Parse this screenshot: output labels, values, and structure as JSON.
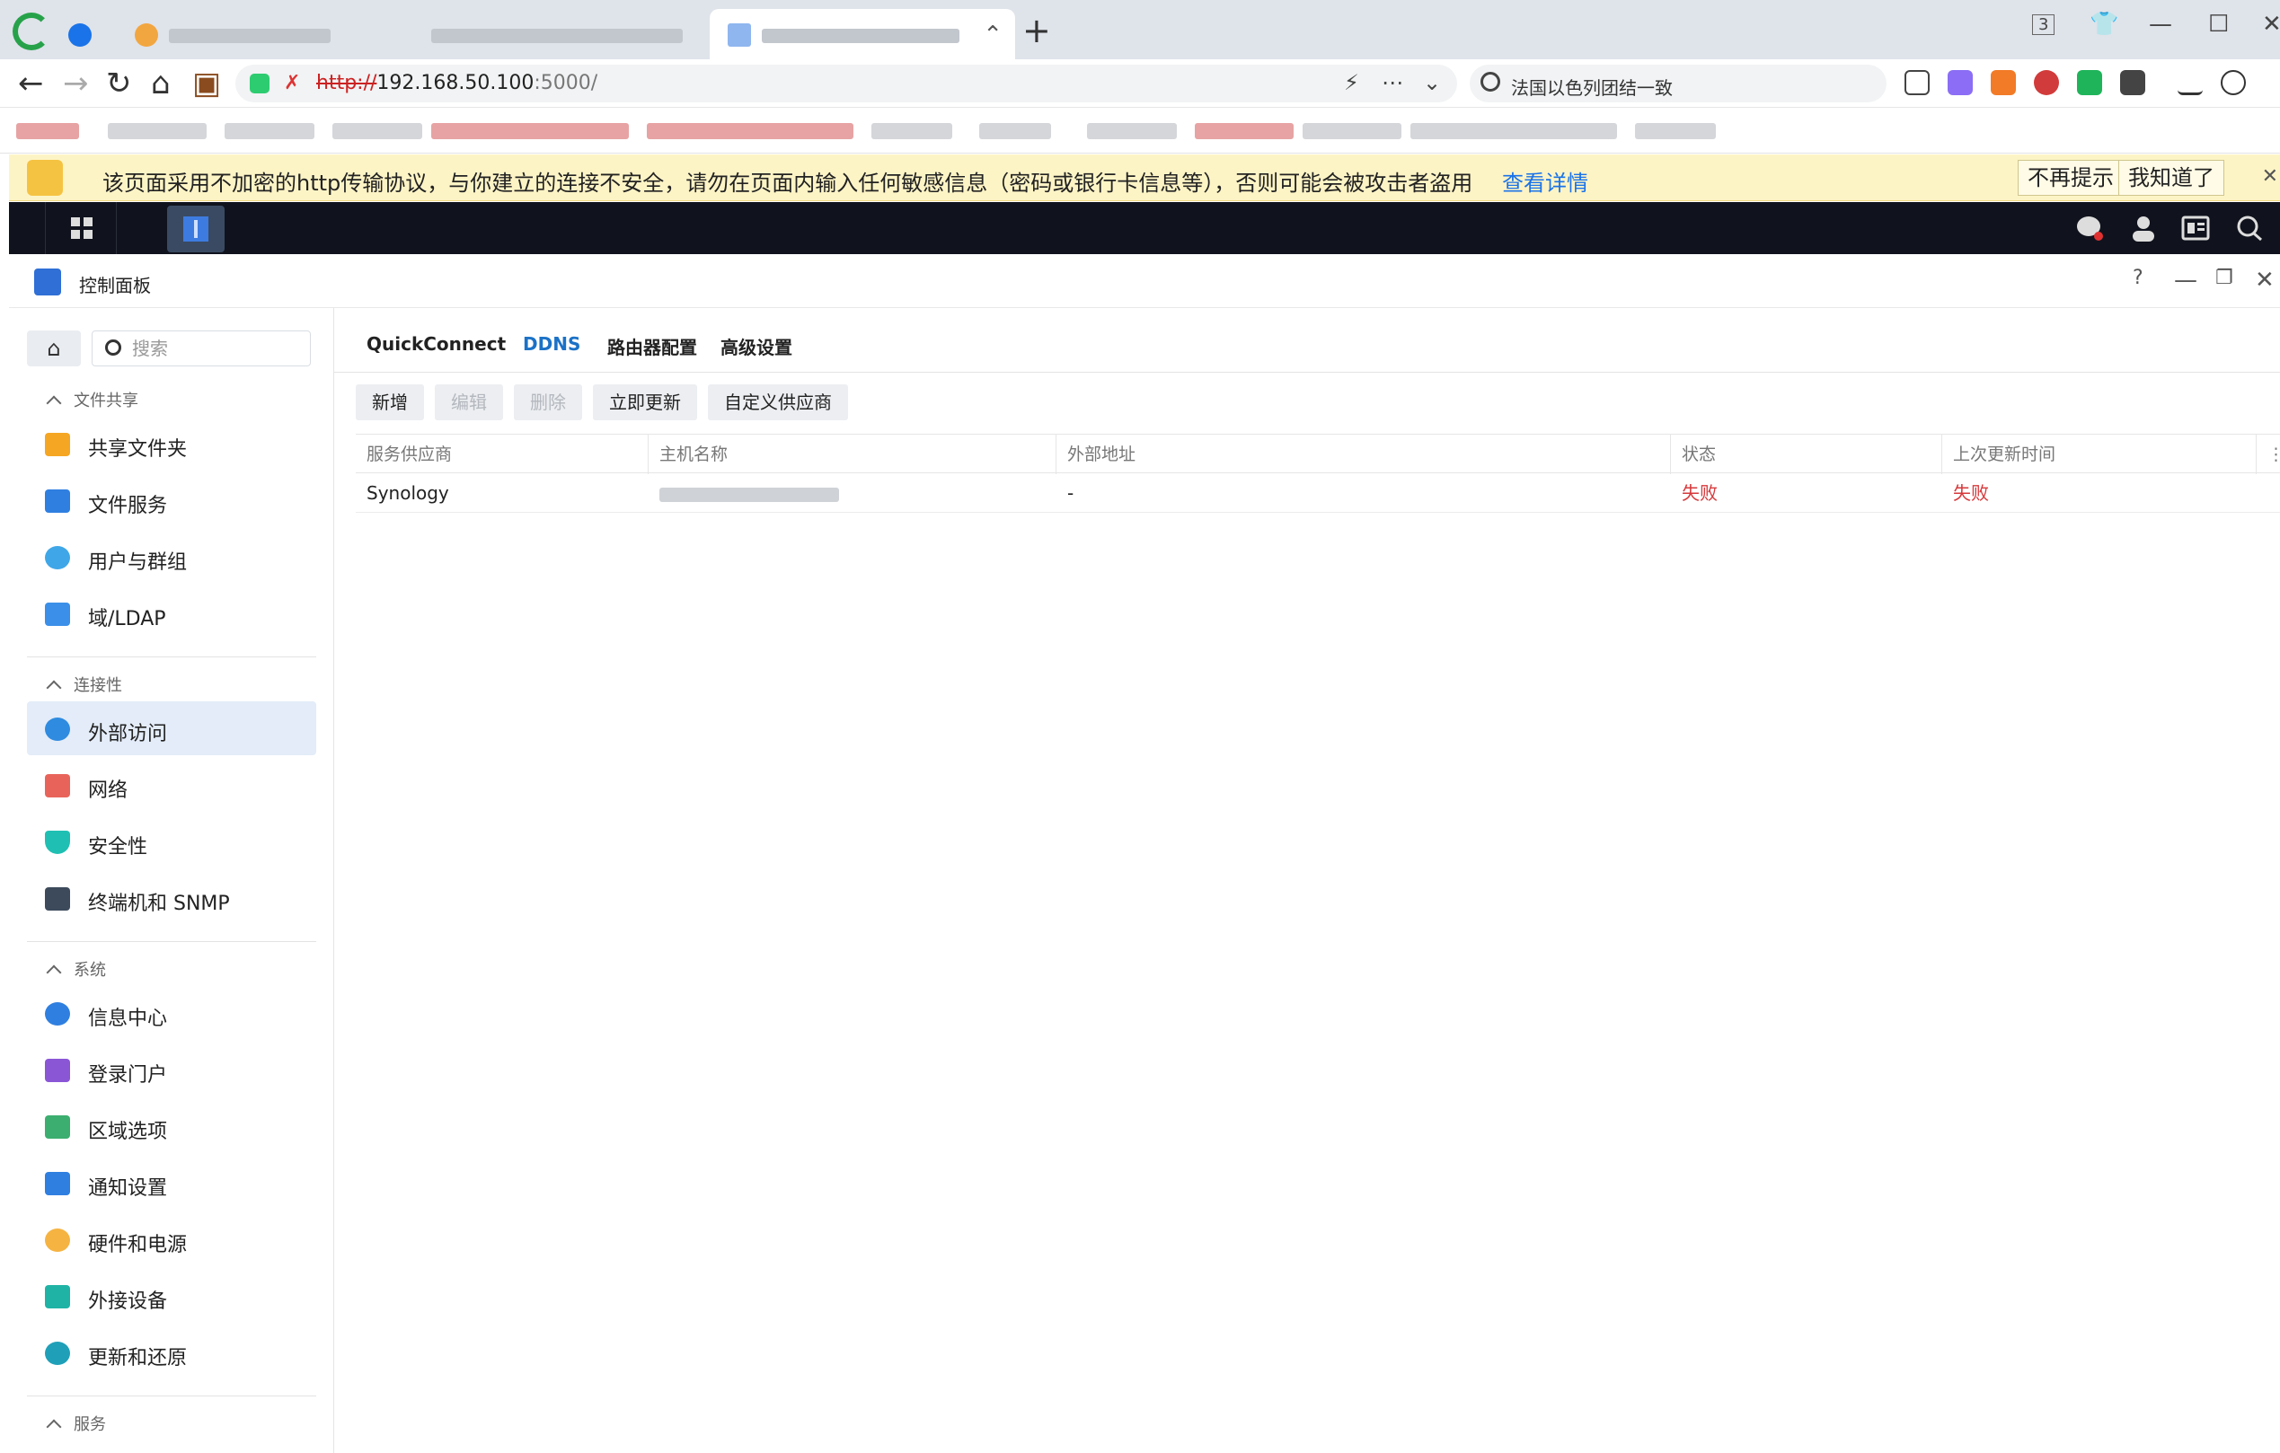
{
  "browser": {
    "url_scheme": "http://",
    "url_host": "192.168.50.100",
    "url_port": ":5000/",
    "search_text": "法国以色列团结一致",
    "tab_count": "3"
  },
  "warning": {
    "message": "该页面采用不加密的http传输协议，与你建立的连接不安全，请勿在页面内输入任何敏感信息（密码或银行卡信息等），否则可能会被攻击者盗用",
    "link": "查看详情",
    "dismiss": "不再提示",
    "ok": "我知道了"
  },
  "window": {
    "title": "控制面板",
    "help": "?"
  },
  "sidebar": {
    "search_placeholder": "搜索",
    "groups": [
      {
        "label": "文件共享",
        "items": [
          "共享文件夹",
          "文件服务",
          "用户与群组",
          "域/LDAP"
        ]
      },
      {
        "label": "连接性",
        "items": [
          "外部访问",
          "网络",
          "安全性",
          "终端机和 SNMP"
        ]
      },
      {
        "label": "系统",
        "items": [
          "信息中心",
          "登录门户",
          "区域选项",
          "通知设置",
          "硬件和电源",
          "外接设备",
          "更新和还原"
        ]
      },
      {
        "label": "服务",
        "items": []
      }
    ],
    "active_item": "外部访问"
  },
  "tabs": [
    "QuickConnect",
    "DDNS",
    "路由器配置",
    "高级设置"
  ],
  "active_tab": "DDNS",
  "toolbar": {
    "add": "新增",
    "edit": "编辑",
    "delete": "删除",
    "update_now": "立即更新",
    "custom_provider": "自定义供应商"
  },
  "table": {
    "columns": [
      "服务供应商",
      "主机名称",
      "外部地址",
      "状态",
      "上次更新时间"
    ],
    "rows": [
      {
        "provider": "Synology",
        "hostname": "",
        "external_address": "-",
        "status": "失败",
        "last_update": "失败"
      }
    ]
  },
  "colors": {
    "accent": "#1b72c7",
    "fail": "#d6383a",
    "warning_bg": "#fdf4c6"
  }
}
